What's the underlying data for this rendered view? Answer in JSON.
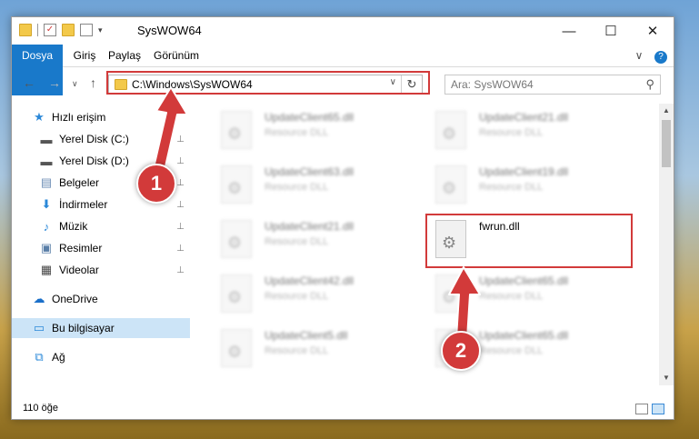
{
  "window": {
    "title": "SysWOW64",
    "minimize": "—",
    "maximize": "☐",
    "close": "✕"
  },
  "ribbon": {
    "tabs": [
      {
        "label": "Dosya"
      },
      {
        "label": "Giriş"
      },
      {
        "label": "Paylaş"
      },
      {
        "label": "Görünüm"
      }
    ],
    "expand": "∨",
    "help": "?"
  },
  "nav": {
    "back": "←",
    "forward": "→",
    "recent": "∨",
    "up": "↑",
    "address": "C:\\Windows\\SysWOW64",
    "address_dropdown": "∨",
    "refresh": "↻",
    "search_placeholder": "Ara: SysWOW64",
    "search_icon": "⚲"
  },
  "sidebar": {
    "items": [
      {
        "label": "Hızlı erişim",
        "icon": "star-icon",
        "glyph": "★",
        "color": "#2b88d8"
      },
      {
        "label": "Yerel Disk (C:)",
        "icon": "drive-icon",
        "glyph": "▬",
        "color": "#555555"
      },
      {
        "label": "Yerel Disk (D:)",
        "icon": "drive-icon",
        "glyph": "▬",
        "color": "#555555"
      },
      {
        "label": "Belgeler",
        "icon": "documents-icon",
        "glyph": "▤",
        "color": "#6b8cb5"
      },
      {
        "label": "İndirmeler",
        "icon": "download-icon",
        "glyph": "⬇",
        "color": "#2b88d8"
      },
      {
        "label": "Müzik",
        "icon": "music-icon",
        "glyph": "♪",
        "color": "#2b88d8"
      },
      {
        "label": "Resimler",
        "icon": "pictures-icon",
        "glyph": "▣",
        "color": "#5a7fa8"
      },
      {
        "label": "Videolar",
        "icon": "videos-icon",
        "glyph": "▦",
        "color": "#444444"
      },
      {
        "label": "OneDrive",
        "icon": "cloud-icon",
        "glyph": "☁",
        "color": "#1a6fc9"
      },
      {
        "label": "Bu bilgisayar",
        "icon": "computer-icon",
        "glyph": "▭",
        "color": "#2b88d8"
      },
      {
        "label": "Ağ",
        "icon": "network-icon",
        "glyph": "⧉",
        "color": "#2b88d8"
      }
    ],
    "pin_glyph": "📌"
  },
  "files": [
    {
      "name": "UpdateClient65.dll",
      "type": "Resource DLL"
    },
    {
      "name": "UpdateClient21.dll",
      "type": "Resource DLL"
    },
    {
      "name": "UpdateClient63.dll",
      "type": "Resource DLL"
    },
    {
      "name": "UpdateClient19.dll",
      "type": "Resource DLL"
    },
    {
      "name": "UpdateClient21.dll",
      "type": "Resource DLL"
    },
    {
      "name": "fwrun.dll",
      "type": ""
    },
    {
      "name": "UpdateClient42.dll",
      "type": "Resource DLL"
    },
    {
      "name": "UpdateClient65.dll",
      "type": "Resource DLL"
    },
    {
      "name": "UpdateClient5.dll",
      "type": "Resource DLL"
    },
    {
      "name": "UpdateClient65.dll",
      "type": "Resource DLL"
    }
  ],
  "status": {
    "count": "110 öğe"
  },
  "annotations": {
    "step1": "1",
    "step2": "2",
    "color": "#d23a3a"
  }
}
